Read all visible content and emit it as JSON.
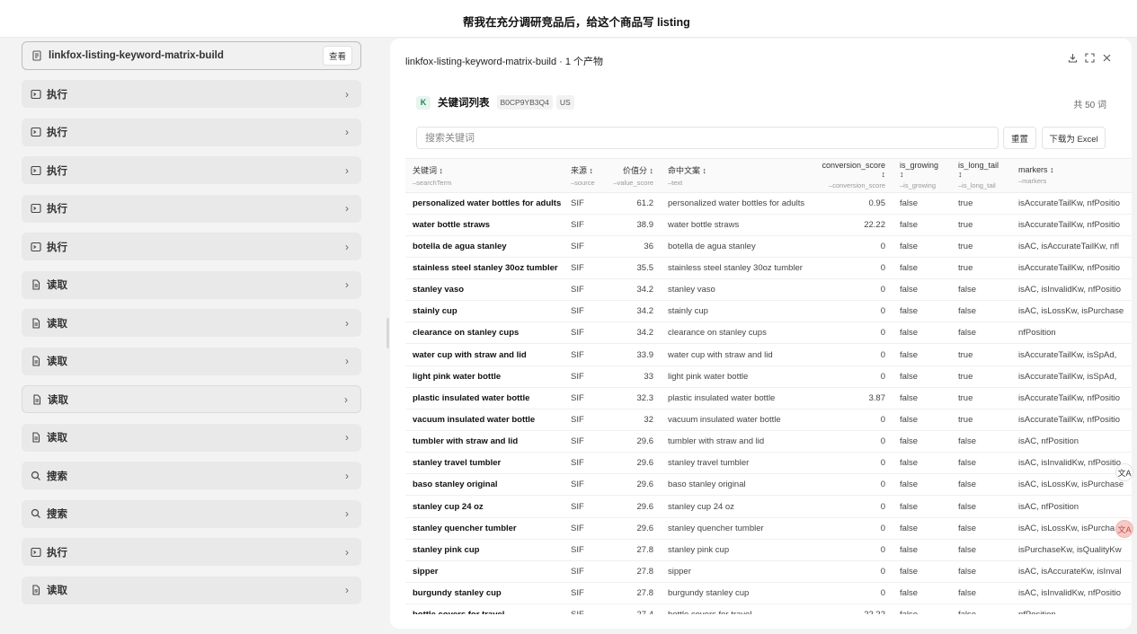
{
  "topbar": {
    "title": "帮我在充分调研竞品后，给这个商品写 listing"
  },
  "left": {
    "artifact": {
      "label": "linkfox-listing-keyword-matrix-build",
      "view_label": "查看"
    },
    "steps": [
      {
        "icon": "terminal-icon",
        "label": "执行"
      },
      {
        "icon": "terminal-icon",
        "label": "执行"
      },
      {
        "icon": "terminal-icon",
        "label": "执行"
      },
      {
        "icon": "terminal-icon",
        "label": "执行"
      },
      {
        "icon": "terminal-icon",
        "label": "执行"
      },
      {
        "icon": "file-icon",
        "label": "读取"
      },
      {
        "icon": "file-icon",
        "label": "读取"
      },
      {
        "icon": "file-icon",
        "label": "读取"
      },
      {
        "icon": "file-icon",
        "label": "读取"
      },
      {
        "icon": "file-icon",
        "label": "读取"
      },
      {
        "icon": "search-icon",
        "label": "搜索"
      },
      {
        "icon": "search-icon",
        "label": "搜索"
      },
      {
        "icon": "terminal-icon",
        "label": "执行"
      },
      {
        "icon": "file-icon",
        "label": "读取"
      }
    ]
  },
  "panel": {
    "header": "linkfox-listing-keyword-matrix-build · 1 个产物",
    "kw_badge": "K",
    "kw_title": "关键词列表",
    "asin": "B0CP9YB3Q4",
    "market": "US",
    "total": "共 50 词",
    "search_placeholder": "搜索关键词",
    "reset_label": "重置",
    "excel_label": "下载为 Excel"
  },
  "table": {
    "columns": [
      {
        "label": "关键词 ↕",
        "field": "–searchTerm"
      },
      {
        "label": "来源 ↕",
        "field": "–source"
      },
      {
        "label": "价值分 ↕",
        "field": "–value_score"
      },
      {
        "label": "命中文案 ↕",
        "field": "–text"
      },
      {
        "label": "conversion_score ↕",
        "field": "–conversion_score"
      },
      {
        "label": "is_growing ↕",
        "field": "–is_growing"
      },
      {
        "label": "is_long_tail ↕",
        "field": "–is_long_tail"
      },
      {
        "label": "markers ↕",
        "field": "–markers"
      }
    ],
    "rows": [
      [
        "personalized water bottles for adults",
        "SIF",
        "61.2",
        "personalized water bottles for adults",
        "0.95",
        "false",
        "true",
        "isAccurateTailKw, nfPositio"
      ],
      [
        "water bottle straws",
        "SIF",
        "38.9",
        "water bottle straws",
        "22.22",
        "false",
        "true",
        "isAccurateTailKw, nfPositio"
      ],
      [
        "botella de agua stanley",
        "SIF",
        "36",
        "botella de agua stanley",
        "0",
        "false",
        "true",
        "isAC, isAccurateTailKw, nfl"
      ],
      [
        "stainless steel stanley 30oz tumbler",
        "SIF",
        "35.5",
        "stainless steel stanley 30oz tumbler",
        "0",
        "false",
        "true",
        "isAccurateTailKw, nfPositio"
      ],
      [
        "stanley vaso",
        "SIF",
        "34.2",
        "stanley vaso",
        "0",
        "false",
        "false",
        "isAC, isInvalidKw, nfPositio"
      ],
      [
        "stainly cup",
        "SIF",
        "34.2",
        "stainly cup",
        "0",
        "false",
        "false",
        "isAC, isLossKw, isPurchase"
      ],
      [
        "clearance on stanley cups",
        "SIF",
        "34.2",
        "clearance on stanley cups",
        "0",
        "false",
        "false",
        "nfPosition"
      ],
      [
        "water cup with straw and lid",
        "SIF",
        "33.9",
        "water cup with straw and lid",
        "0",
        "false",
        "true",
        "isAccurateTailKw, isSpAd,"
      ],
      [
        "light pink water bottle",
        "SIF",
        "33",
        "light pink water bottle",
        "0",
        "false",
        "true",
        "isAccurateTailKw, isSpAd,"
      ],
      [
        "plastic insulated water bottle",
        "SIF",
        "32.3",
        "plastic insulated water bottle",
        "3.87",
        "false",
        "true",
        "isAccurateTailKw, nfPositio"
      ],
      [
        "vacuum insulated water bottle",
        "SIF",
        "32",
        "vacuum insulated water bottle",
        "0",
        "false",
        "true",
        "isAccurateTailKw, nfPositio"
      ],
      [
        "tumbler with straw and lid",
        "SIF",
        "29.6",
        "tumbler with straw and lid",
        "0",
        "false",
        "false",
        "isAC, nfPosition"
      ],
      [
        "stanley travel tumbler",
        "SIF",
        "29.6",
        "stanley travel tumbler",
        "0",
        "false",
        "false",
        "isAC, isInvalidKw, nfPositio"
      ],
      [
        "baso stanley original",
        "SIF",
        "29.6",
        "baso stanley original",
        "0",
        "false",
        "false",
        "isAC, isLossKw, isPurchase"
      ],
      [
        "stanley cup 24 oz",
        "SIF",
        "29.6",
        "stanley cup 24 oz",
        "0",
        "false",
        "false",
        "isAC, nfPosition"
      ],
      [
        "stanley quencher tumbler",
        "SIF",
        "29.6",
        "stanley quencher tumbler",
        "0",
        "false",
        "false",
        "isAC, isLossKw, isPurcha"
      ],
      [
        "stanley pink cup",
        "SIF",
        "27.8",
        "stanley pink cup",
        "0",
        "false",
        "false",
        "isPurchaseKw, isQualityKw"
      ],
      [
        "sipper",
        "SIF",
        "27.8",
        "sipper",
        "0",
        "false",
        "false",
        "isAC, isAccurateKw, isInval"
      ],
      [
        "burgundy stanley cup",
        "SIF",
        "27.8",
        "burgundy stanley cup",
        "0",
        "false",
        "false",
        "isAC, isInvalidKw, nfPositio"
      ],
      [
        "bottle covers for travel",
        "SIF",
        "27.4",
        "bottle covers for travel",
        "22.22",
        "false",
        "false",
        "nfPosition"
      ]
    ]
  },
  "floats": {
    "translate": "文A",
    "ai": "文A"
  }
}
